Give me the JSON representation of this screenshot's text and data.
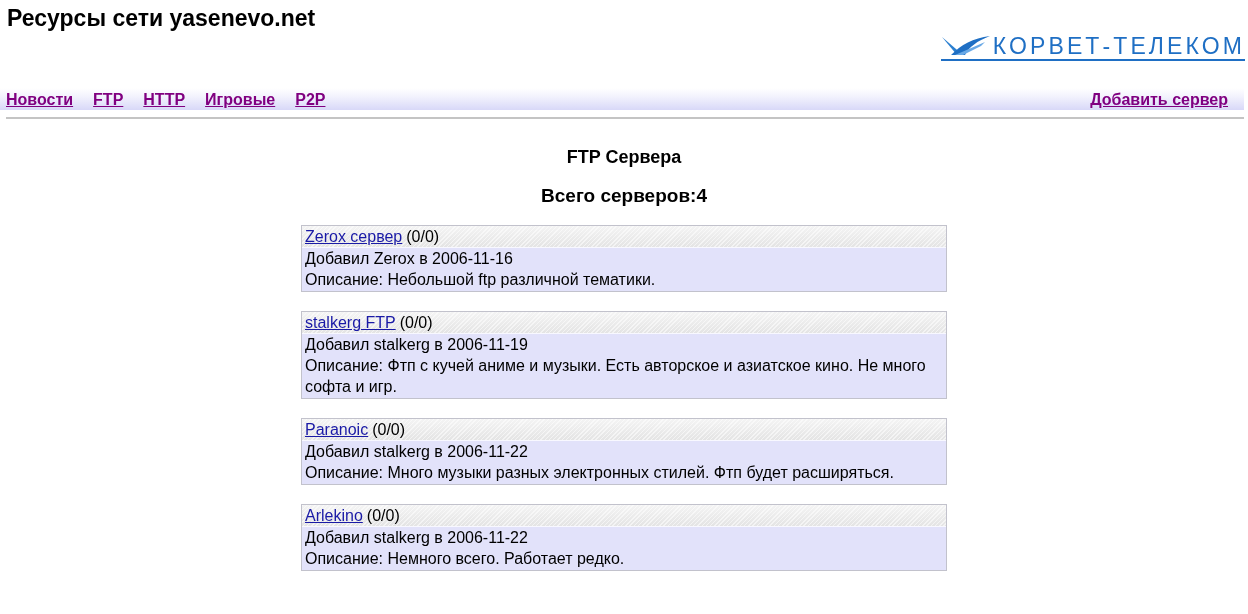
{
  "header": {
    "title": "Ресурсы сети yasenevo.net",
    "logo_text": "КОРВЕТ-ТЕЛЕКОМ"
  },
  "nav": {
    "links": [
      "Новости",
      "FTP",
      "HTTP",
      "Игровые",
      "P2P"
    ],
    "action": "Добавить сервер"
  },
  "page": {
    "heading": "FTP Сервера",
    "total": "Всего серверов:4"
  },
  "servers": [
    {
      "name": "Zerox сервер",
      "rating": "(0/0)",
      "added": "Добавил Zerox в 2006-11-16",
      "description": "Описание: Небольшой ftp различной тематики."
    },
    {
      "name": "stalkerg FTP",
      "rating": "(0/0)",
      "added": "Добавил stalkerg в 2006-11-19",
      "description": "Описание: Фтп с кучей аниме и музыки. Есть авторское и азиатское кино. Не много софта и игр."
    },
    {
      "name": "Paranoic",
      "rating": "(0/0)",
      "added": "Добавил stalkerg в 2006-11-22",
      "description": "Описание: Много музыки разных электронных стилей. Фтп будет расширяться."
    },
    {
      "name": "Arlekino",
      "rating": "(0/0)",
      "added": "Добавил stalkerg в 2006-11-22",
      "description": "Описание: Немного всего. Работает редко."
    }
  ]
}
